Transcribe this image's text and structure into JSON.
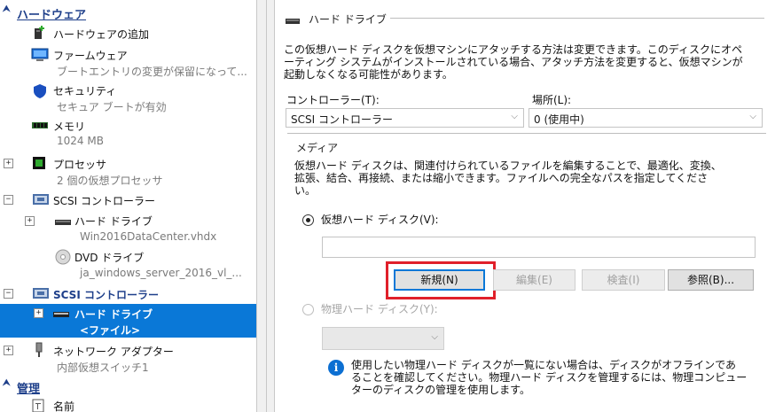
{
  "tree": {
    "hardware_section": "ハードウェア",
    "manage_section": "管理",
    "items": {
      "add_hardware": "ハードウェアの追加",
      "firmware": "ファームウェア",
      "firmware_sub": "ブートエントリの変更が保留になって...",
      "security": "セキュリティ",
      "security_sub": "セキュア ブートが有効",
      "memory": "メモリ",
      "memory_sub": "1024 MB",
      "processor": "プロセッサ",
      "processor_sub": "2 個の仮想プロセッサ",
      "scsi1": "SCSI コントローラー",
      "hdd1": "ハード ドライブ",
      "hdd1_sub": "Win2016DataCenter.vhdx",
      "dvd": "DVD ドライブ",
      "dvd_sub": "ja_windows_server_2016_vl_...",
      "scsi2": "SCSI コントローラー",
      "hdd2": "ハード ドライブ",
      "hdd2_sub": "<ファイル>",
      "network": "ネットワーク アダプター",
      "network_sub": "内部仮想スイッチ1",
      "name": "名前"
    },
    "expanders": {
      "processor": "+",
      "scsi1": "−",
      "hdd1": "+",
      "scsi2": "−",
      "hdd2": "+",
      "network": "+"
    }
  },
  "panel": {
    "group_title": "ハード ドライブ",
    "intro_line1": "この仮想ハード ディスクを仮想マシンにアタッチする方法は変更できます。このディスクにオペ",
    "intro_line2": "ーティング システムがインストールされている場合、アタッチ方法を変更すると、仮想マシンが",
    "intro_line3": "起動しなくなる可能性があります。",
    "controller_label": "コントローラー(T):",
    "controller_value": "SCSI コントローラー",
    "location_label": "場所(L):",
    "location_value": "0 (使用中)",
    "media_title": "メディア",
    "media_line1": "仮想ハード ディスクは、関連付けられているファイルを編集することで、最適化、変換、",
    "media_line2": "拡張、結合、再接続、または縮小できます。ファイルへの完全なパスを指定してくださ",
    "media_line3": "い。",
    "vhd_radio": "仮想ハード ディスク(V):",
    "vhd_path": "",
    "btn_new": "新規(N)",
    "btn_edit": "編集(E)",
    "btn_inspect": "検査(I)",
    "btn_browse": "参照(B)...",
    "phys_radio": "物理ハード ディスク(Y):",
    "phys_value": "",
    "info_line1": "使用したい物理ハード ディスクが一覧にない場合は、ディスクがオフラインであ",
    "info_line2": "ることを確認してください。物理ハード ディスクを管理するには、物理コンピュー",
    "info_line3": "ターのディスクの管理を使用します。"
  },
  "colors": {
    "selection": "#0a78d7",
    "highlight_box": "#e0202a",
    "section_header": "#1e3f8a"
  }
}
